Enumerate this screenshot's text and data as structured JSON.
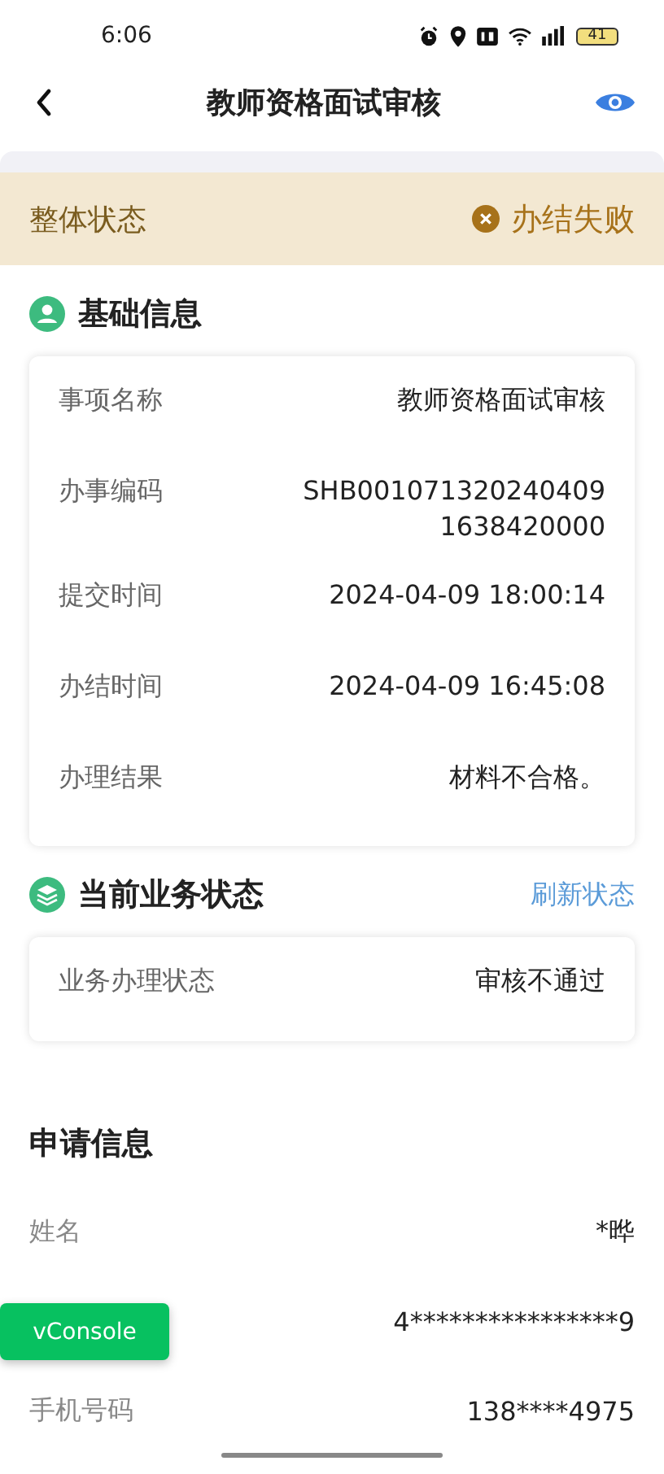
{
  "status_bar": {
    "time": "6:06",
    "battery": "41"
  },
  "header": {
    "title": "教师资格面试审核"
  },
  "overall_status": {
    "label": "整体状态",
    "value": "办结失败"
  },
  "basic_info": {
    "title": "基础信息",
    "rows": [
      {
        "label": "事项名称",
        "value": "教师资格面试审核"
      },
      {
        "label": "办事编码",
        "value": "SHB0010713202404091638420000"
      },
      {
        "label": "提交时间",
        "value": "2024-04-09 18:00:14"
      },
      {
        "label": "办结时间",
        "value": "2024-04-09 16:45:08"
      },
      {
        "label": "办理结果",
        "value": "材料不合格。"
      }
    ]
  },
  "business_status": {
    "title": "当前业务状态",
    "action": "刷新状态",
    "rows": [
      {
        "label": "业务办理状态",
        "value": "审核不通过"
      }
    ]
  },
  "application": {
    "title": "申请信息",
    "rows": [
      {
        "label": "姓名",
        "value": "*晔"
      },
      {
        "value": "4****************9"
      },
      {
        "label": "手机号码",
        "value": "138****4975"
      }
    ]
  },
  "vconsole": {
    "label": "vConsole"
  }
}
